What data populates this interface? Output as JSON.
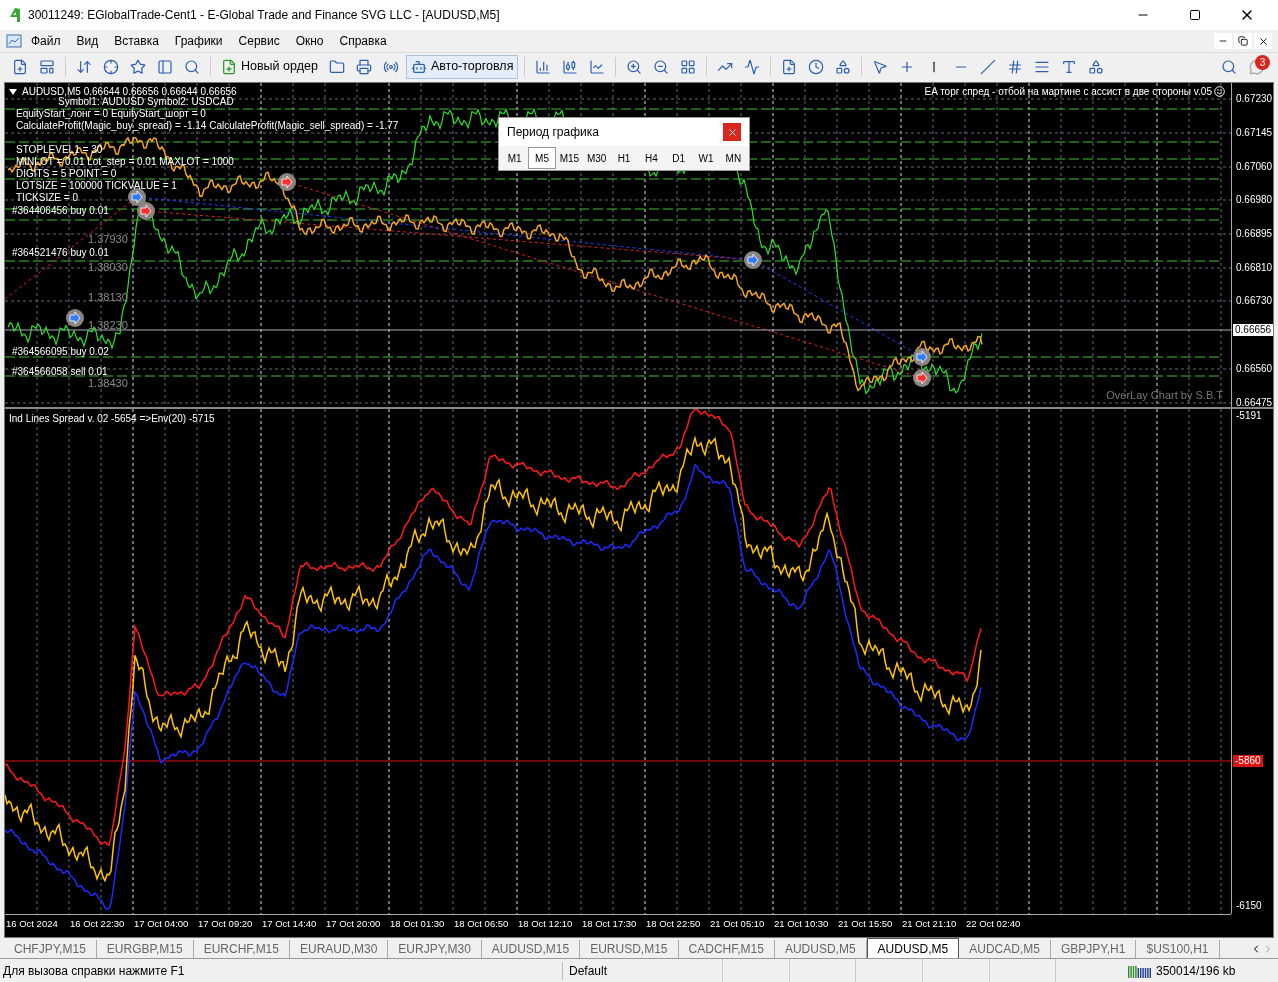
{
  "window": {
    "title": "30011249: EGlobalTrade-Cent1 - E-Global Trade and Finance SVG LLC - [AUDUSD,M5]"
  },
  "menu": [
    "Файл",
    "Вид",
    "Вставка",
    "Графики",
    "Сервис",
    "Окно",
    "Справка"
  ],
  "toolbar": {
    "new_order": "Новый ордер",
    "autotrade": "Авто-торговля",
    "notification_count": "3"
  },
  "chart": {
    "header": "AUDUSD,M5  0.66644 0.66656 0.66644 0.66656",
    "ea_title": "EA торг спред - отбой на мартине с ассист в две стороны v.05",
    "info_lines": [
      "Symbol1: AUDUSD Symbol2: USDCAD",
      "EquityStart_лонг = 0 EquityStart_шорт = 0",
      "CalculateProfit(Magic_buy_spread) = -1.14 CalculateProfit(Magic_sell_spread) = -1.77",
      "STOPLEVEL1 = 30",
      "MINLOT = 0.01 Lot_step = 0.01 MAXLOT = 1000",
      "DIGITS = 5 POINT = 0",
      "LOTSIZE = 100000 TICKVALUE = 1",
      "TICKSIZE = 0"
    ],
    "order_labels": [
      "#364406456 buy 0.01",
      "#364521476 buy 0.01",
      "#364566095 buy 0.02",
      "#364566058 sell 0.01"
    ],
    "symbol2_ticks": [
      "1.37930",
      "1.38030",
      "1.38130",
      "1.38230",
      "1.38430"
    ],
    "price_ticks": [
      "0.67230",
      "0.67145",
      "0.67060",
      "0.66980",
      "0.66895",
      "0.66810",
      "0.66730",
      "0.66560",
      "0.66475"
    ],
    "current_price": "0.66656",
    "credit": "OverLay Chart by S.B.T"
  },
  "indicator": {
    "label": "Ind Lines Spread  v. 02 -5654  =>Env(20) -5715",
    "top_tick": "-5191",
    "bottom_tick": "-6150",
    "level_label": "-5860"
  },
  "time_axis": [
    "16 Oct 2024",
    "16 Oct 22:30",
    "17 Oct 04:00",
    "17 Oct 09:20",
    "17 Oct 14:40",
    "17 Oct 20:00",
    "18 Oct 01:30",
    "18 Oct 06:50",
    "18 Oct 12:10",
    "18 Oct 17:30",
    "18 Oct 22:50",
    "21 Oct 05:10",
    "21 Oct 10:30",
    "21 Oct 15:50",
    "21 Oct 21:10",
    "22 Oct 02:40"
  ],
  "period_dialog": {
    "title": "Период графика",
    "periods": [
      {
        "label": "M1",
        "selected": false
      },
      {
        "label": "M5",
        "selected": true
      },
      {
        "label": "M15",
        "selected": false
      },
      {
        "label": "M30",
        "selected": false
      },
      {
        "label": "H1",
        "selected": false
      },
      {
        "label": "H4",
        "selected": false
      },
      {
        "label": "D1",
        "selected": false
      },
      {
        "label": "W1",
        "selected": false
      },
      {
        "label": "MN",
        "selected": false
      }
    ]
  },
  "tabs": [
    {
      "label": "CHFJPY,M15",
      "selected": false
    },
    {
      "label": "EURGBP,M15",
      "selected": false
    },
    {
      "label": "EURCHF,M15",
      "selected": false
    },
    {
      "label": "EURAUD,M30",
      "selected": false
    },
    {
      "label": "EURJPY,M30",
      "selected": false
    },
    {
      "label": "AUDUSD,M15",
      "selected": false
    },
    {
      "label": "EURUSD,M15",
      "selected": false
    },
    {
      "label": "CADCHF,M15",
      "selected": false
    },
    {
      "label": "AUDUSD,M5",
      "selected": false
    },
    {
      "label": "AUDUSD,M5",
      "selected": true
    },
    {
      "label": "AUDCAD,M5",
      "selected": false
    },
    {
      "label": "GBPJPY,H1",
      "selected": false
    },
    {
      "label": "$US100,H1",
      "selected": false
    }
  ],
  "status_bar": {
    "help": "Для вызова справки нажмите F1",
    "profile": "Default",
    "traffic": "350014/196 kb"
  }
}
